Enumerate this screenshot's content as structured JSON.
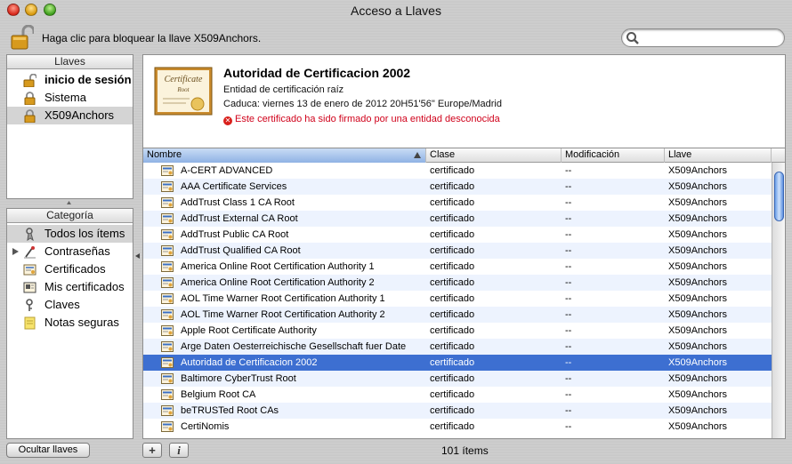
{
  "window": {
    "title": "Acceso a Llaves"
  },
  "toolbar": {
    "lock_text": "Haga clic para bloquear la llave X509Anchors.",
    "search_placeholder": ""
  },
  "keychains": {
    "header": "Llaves",
    "items": [
      {
        "label": "inicio de sesión",
        "icon": "lock-open-icon",
        "bold": true,
        "selected": false
      },
      {
        "label": "Sistema",
        "icon": "lock-icon",
        "bold": false,
        "selected": false
      },
      {
        "label": "X509Anchors",
        "icon": "lock-icon",
        "bold": false,
        "selected": true
      }
    ]
  },
  "category": {
    "header": "Categoría",
    "items": [
      {
        "label": "Todos los ítems",
        "icon": "all-items-icon",
        "selected": true
      },
      {
        "label": "Contraseñas",
        "icon": "passwords-icon",
        "selected": false
      },
      {
        "label": "Certificados",
        "icon": "certificate-icon",
        "selected": false
      },
      {
        "label": "Mis certificados",
        "icon": "my-certificate-icon",
        "selected": false
      },
      {
        "label": "Claves",
        "icon": "key-icon",
        "selected": false
      },
      {
        "label": "Notas seguras",
        "icon": "note-icon",
        "selected": false
      }
    ]
  },
  "details": {
    "title": "Autoridad de Certificacion 2002",
    "kind": "Entidad de certificación raíz",
    "expires": "Caduca: viernes 13 de enero de 2012 20H51'56\" Europe/Madrid",
    "warning": "Este certificado ha sido firmado por una entidad desconocida",
    "cert_image_text_1": "Certificate",
    "cert_image_text_2": "Root"
  },
  "table": {
    "columns": {
      "name": "Nombre",
      "class": "Clase",
      "modified": "Modificación",
      "keychain": "Llave"
    },
    "rows": [
      {
        "name": "A-CERT ADVANCED",
        "class": "certificado",
        "modified": "--",
        "keychain": "X509Anchors"
      },
      {
        "name": "AAA Certificate Services",
        "class": "certificado",
        "modified": "--",
        "keychain": "X509Anchors"
      },
      {
        "name": "AddTrust Class 1 CA Root",
        "class": "certificado",
        "modified": "--",
        "keychain": "X509Anchors"
      },
      {
        "name": "AddTrust External CA Root",
        "class": "certificado",
        "modified": "--",
        "keychain": "X509Anchors"
      },
      {
        "name": "AddTrust Public CA Root",
        "class": "certificado",
        "modified": "--",
        "keychain": "X509Anchors"
      },
      {
        "name": "AddTrust Qualified CA Root",
        "class": "certificado",
        "modified": "--",
        "keychain": "X509Anchors"
      },
      {
        "name": "America Online Root Certification Authority 1",
        "class": "certificado",
        "modified": "--",
        "keychain": "X509Anchors"
      },
      {
        "name": "America Online Root Certification Authority 2",
        "class": "certificado",
        "modified": "--",
        "keychain": "X509Anchors"
      },
      {
        "name": "AOL Time Warner Root Certification Authority 1",
        "class": "certificado",
        "modified": "--",
        "keychain": "X509Anchors"
      },
      {
        "name": "AOL Time Warner Root Certification Authority 2",
        "class": "certificado",
        "modified": "--",
        "keychain": "X509Anchors"
      },
      {
        "name": "Apple Root Certificate Authority",
        "class": "certificado",
        "modified": "--",
        "keychain": "X509Anchors"
      },
      {
        "name": "Arge Daten Oesterreichische Gesellschaft fuer Date",
        "class": "certificado",
        "modified": "--",
        "keychain": "X509Anchors"
      },
      {
        "name": "Autoridad de Certificacion 2002",
        "class": "certificado",
        "modified": "--",
        "keychain": "X509Anchors",
        "selected": true
      },
      {
        "name": "Baltimore CyberTrust Root",
        "class": "certificado",
        "modified": "--",
        "keychain": "X509Anchors"
      },
      {
        "name": "Belgium Root CA",
        "class": "certificado",
        "modified": "--",
        "keychain": "X509Anchors"
      },
      {
        "name": "beTRUSTed Root CAs",
        "class": "certificado",
        "modified": "--",
        "keychain": "X509Anchors"
      },
      {
        "name": "CertiNomis",
        "class": "certificado",
        "modified": "--",
        "keychain": "X509Anchors"
      }
    ]
  },
  "footer": {
    "hide_button": "Ocultar llaves",
    "add_button": "+",
    "info_button": "i",
    "count": "101 ítems"
  },
  "colors": {
    "selection": "#3d6fd1",
    "warning": "#d0021b",
    "stripe": "#edf3fe"
  }
}
